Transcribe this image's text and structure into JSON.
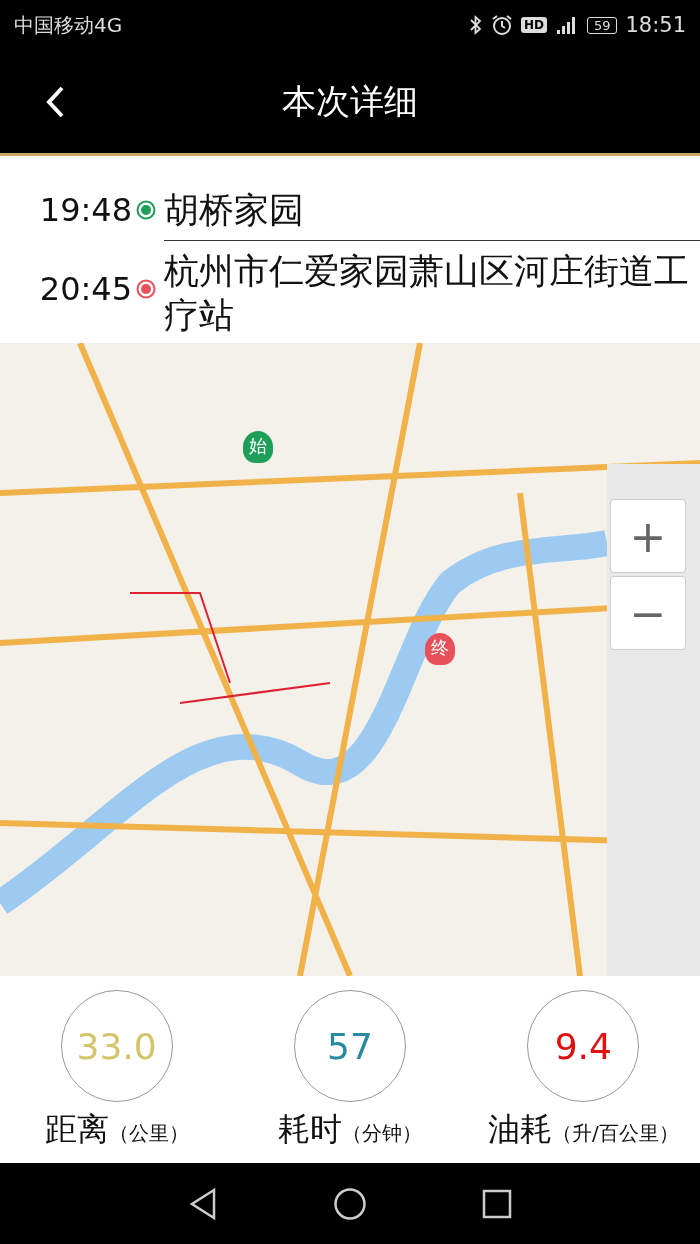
{
  "status_bar": {
    "carrier": "中国移动4G",
    "hd_badge": "HD",
    "battery": "59",
    "time": "18:51"
  },
  "header": {
    "title": "本次详细"
  },
  "route": [
    {
      "kind": "start",
      "time": "19:48",
      "place": "胡桥家园"
    },
    {
      "kind": "end",
      "time": "20:45",
      "place": "杭州市仁爱家园萧山区河庄街道工疗站"
    }
  ],
  "map": {
    "pins": [
      {
        "kind": "start",
        "label": "始"
      },
      {
        "kind": "end",
        "label": "终"
      }
    ],
    "zoom_in": "+",
    "zoom_out": "−"
  },
  "stats": [
    {
      "value": "33.0",
      "color": "#d4c46a",
      "label": "距离",
      "unit": "（公里）"
    },
    {
      "value": "57",
      "color": "#2a8aa0",
      "label": "耗时",
      "unit": "（分钟）"
    },
    {
      "value": "9.4",
      "color": "#e01010",
      "label": "油耗",
      "unit": "（升/百公里）"
    }
  ]
}
